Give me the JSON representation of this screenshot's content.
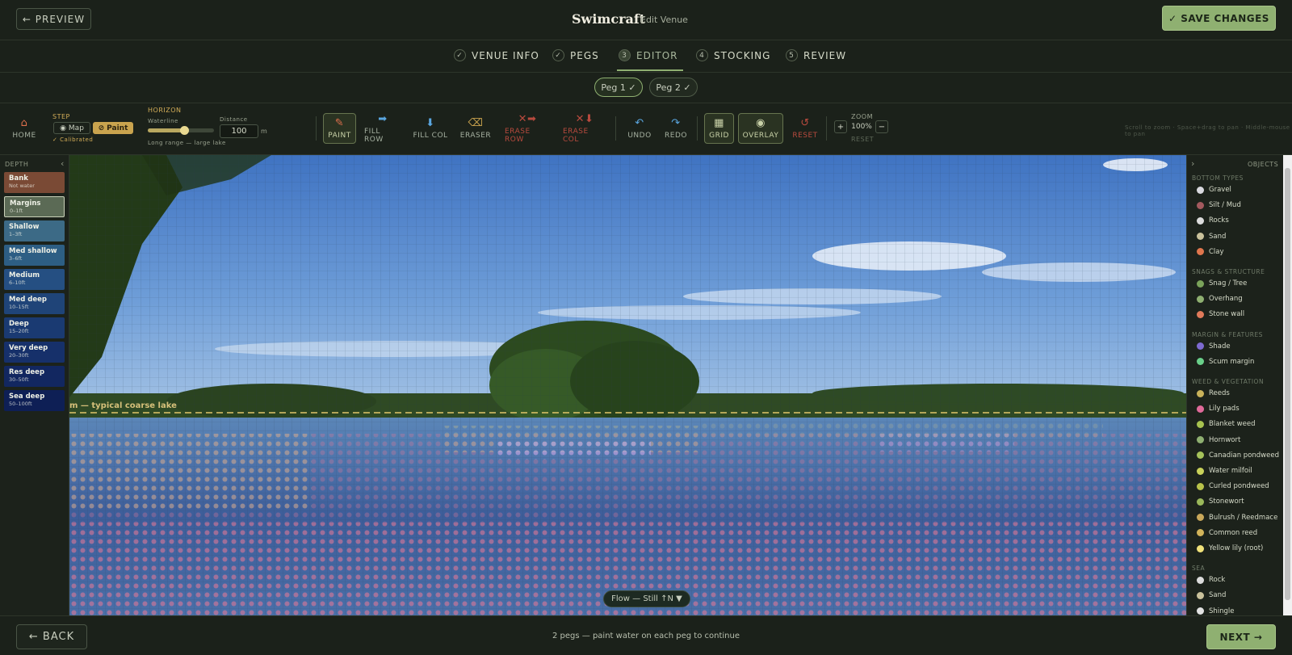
{
  "header": {
    "preview_label": "← PREVIEW",
    "brand": "Swimcraft",
    "subtitle": "Edit Venue",
    "save_label": "✓ SAVE CHANGES"
  },
  "steps": [
    {
      "icon": "✓",
      "label": "VENUE INFO"
    },
    {
      "icon": "✓",
      "label": "PEGS"
    },
    {
      "icon": "3",
      "label": "EDITOR"
    },
    {
      "icon": "4",
      "label": "STOCKING"
    },
    {
      "icon": "5",
      "label": "REVIEW"
    }
  ],
  "pegs": [
    {
      "label": "Peg 1 ✓"
    },
    {
      "label": "Peg 2 ✓"
    }
  ],
  "toolbar": {
    "home_label": "HOME",
    "step_label": "STEP",
    "map_label": "Map",
    "paint_step_label": "Paint",
    "calibrated": "✓ Calibrated",
    "horizon_label": "HORIZON",
    "waterline_label": "Waterline",
    "waterline_value": 0.55,
    "distance_label": "Distance",
    "distance_value": "100",
    "distance_unit": "m",
    "range_label": "Long range — large lake",
    "tools": [
      {
        "label": "PAINT",
        "icon": "🖌"
      },
      {
        "label": "FILL ROW",
        "icon": "➡"
      },
      {
        "label": "FILL COL",
        "icon": "⬇"
      },
      {
        "label": "ERASER",
        "icon": "⌫"
      },
      {
        "label": "ERASE ROW",
        "icon": "✕➡"
      },
      {
        "label": "ERASE COL",
        "icon": "✕⬇"
      },
      {
        "label": "UNDO",
        "icon": "↶"
      },
      {
        "label": "REDO",
        "icon": "↷"
      },
      {
        "label": "GRID",
        "icon": "▦"
      },
      {
        "label": "OVERLAY",
        "icon": "👁"
      },
      {
        "label": "RESET",
        "icon": "↺"
      }
    ],
    "zoom_label": "ZOOM",
    "zoom_in": "+",
    "zoom_value": "100%",
    "zoom_out": "−",
    "zoom_reset": "RESET",
    "hint": "Scroll to zoom · Space+drag to pan · Middle-mouse to pan"
  },
  "depth": {
    "title": "DEPTH",
    "collapse": "‹",
    "items": [
      {
        "name": "Bank",
        "range": "Not water",
        "color": "#7a4a35"
      },
      {
        "name": "Margins",
        "range": "0–1ft",
        "color": "#5b6a55"
      },
      {
        "name": "Shallow",
        "range": "1–3ft",
        "color": "#3c6a86"
      },
      {
        "name": "Med shallow",
        "range": "3–6ft",
        "color": "#2d5e84"
      },
      {
        "name": "Medium",
        "range": "6–10ft",
        "color": "#254f82"
      },
      {
        "name": "Med deep",
        "range": "10–15ft",
        "color": "#1f4478"
      },
      {
        "name": "Deep",
        "range": "15–20ft",
        "color": "#1a3a72"
      },
      {
        "name": "Very deep",
        "range": "20–30ft",
        "color": "#16306a"
      },
      {
        "name": "Res deep",
        "range": "30–50ft",
        "color": "#122760"
      },
      {
        "name": "Sea deep",
        "range": "50–100ft",
        "color": "#0e1f55"
      }
    ]
  },
  "canvas": {
    "horizon_label": "m — typical coarse lake",
    "flow_label": "Flow — Still ↑N ▼"
  },
  "objects": {
    "title": "OBJECTS",
    "expand": "›",
    "groups": [
      {
        "title": "BOTTOM TYPES",
        "items": [
          {
            "label": "Gravel",
            "color": "#d9d9df"
          },
          {
            "label": "Silt / Mud",
            "color": "#a3595e"
          },
          {
            "label": "Rocks",
            "color": "#dcdcdc"
          },
          {
            "label": "Sand",
            "color": "#c9c19b"
          },
          {
            "label": "Clay",
            "color": "#e0764d"
          }
        ]
      },
      {
        "title": "SNAGS & STRUCTURE",
        "items": [
          {
            "label": "Snag / Tree",
            "color": "#7aa35a"
          },
          {
            "label": "Overhang",
            "color": "#8fb071"
          },
          {
            "label": "Stone wall",
            "color": "#e07a5a"
          }
        ]
      },
      {
        "title": "MARGIN & FEATURES",
        "items": [
          {
            "label": "Shade",
            "color": "#7d6ad0"
          },
          {
            "label": "Scum margin",
            "color": "#6ad08a"
          }
        ]
      },
      {
        "title": "WEED & VEGETATION",
        "items": [
          {
            "label": "Reeds",
            "color": "#c9b25a"
          },
          {
            "label": "Lily pads",
            "color": "#e06a9a"
          },
          {
            "label": "Blanket weed",
            "color": "#a7c24f"
          },
          {
            "label": "Hornwort",
            "color": "#8fb071"
          },
          {
            "label": "Canadian pondweed",
            "color": "#a5c25a"
          },
          {
            "label": "Water milfoil",
            "color": "#c9d25a"
          },
          {
            "label": "Curled pondweed",
            "color": "#b8c24a"
          },
          {
            "label": "Stonewort",
            "color": "#9ab85a"
          },
          {
            "label": "Bulrush / Reedmace",
            "color": "#c9a85a"
          },
          {
            "label": "Common reed",
            "color": "#d2b45a"
          },
          {
            "label": "Yellow lily (root)",
            "color": "#f0e27a"
          }
        ]
      },
      {
        "title": "SEA",
        "items": [
          {
            "label": "Rock",
            "color": "#dcdcdc"
          },
          {
            "label": "Sand",
            "color": "#c9c19b"
          },
          {
            "label": "Shingle",
            "color": "#e2e2e2"
          }
        ]
      }
    ]
  },
  "footer": {
    "back_label": "← BACK",
    "status": "2 pegs — paint water on each peg to continue",
    "next_label": "NEXT →"
  },
  "colors": {
    "accent": "#8fb071",
    "danger": "#b84a3e",
    "gold": "#d3ad58"
  }
}
